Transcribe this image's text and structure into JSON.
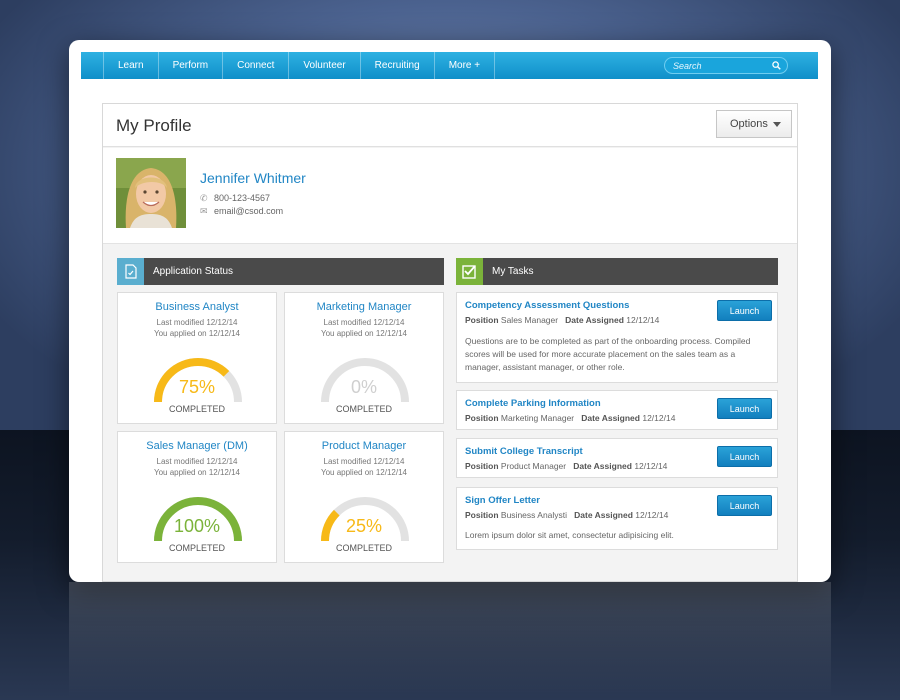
{
  "nav": {
    "items": [
      {
        "label": "Learn"
      },
      {
        "label": "Perform"
      },
      {
        "label": "Connect"
      },
      {
        "label": "Volunteer"
      },
      {
        "label": "Recruiting"
      },
      {
        "label": "More +"
      }
    ],
    "search_placeholder": "Search"
  },
  "header": {
    "title": "My Profile",
    "options_label": "Options"
  },
  "profile": {
    "name": "Jennifer Whitmer",
    "phone": "800-123-4567",
    "email": "email@csod.com"
  },
  "application_status": {
    "title": "Application Status",
    "cards": [
      {
        "title": "Business Analyst",
        "modified": "Last modified 12/12/14",
        "applied": "You applied on 12/12/14",
        "percent": 75,
        "percent_label": "75%",
        "status": "COMPLETED",
        "color": "#f7b918"
      },
      {
        "title": "Marketing Manager",
        "modified": "Last modified 12/12/14",
        "applied": "You applied on 12/12/14",
        "percent": 0,
        "percent_label": "0%",
        "status": "COMPLETED",
        "color": "#cccccc"
      },
      {
        "title": "Sales Manager (DM)",
        "modified": "Last modified 12/12/14",
        "applied": "You applied on 12/12/14",
        "percent": 100,
        "percent_label": "100%",
        "status": "COMPLETED",
        "color": "#7bb33a"
      },
      {
        "title": "Product Manager",
        "modified": "Last modified 12/12/14",
        "applied": "You applied on 12/12/14",
        "percent": 25,
        "percent_label": "25%",
        "status": "COMPLETED",
        "color": "#f7b918"
      }
    ]
  },
  "tasks": {
    "title": "My Tasks",
    "position_label": "Position",
    "date_label": "Date Assigned",
    "launch_label": "Launch",
    "items": [
      {
        "title": "Competency Assessment Questions",
        "position": "Sales Manager",
        "date": "12/12/14",
        "description": "Questions are to be completed as part of the onboarding process. Compiled scores will be used for more accurate placement on the sales team as a manager, assistant manager, or other role."
      },
      {
        "title": "Complete Parking Information",
        "position": "Marketing Manager",
        "date": "12/12/14",
        "description": ""
      },
      {
        "title": "Submit College Transcript",
        "position": "Product Manager",
        "date": "12/12/14",
        "description": ""
      },
      {
        "title": "Sign Offer Letter",
        "position": "Business Analysti",
        "date": "12/12/14",
        "description": "Lorem ipsum dolor sit amet, consectetur adipisicing elit."
      }
    ]
  },
  "colors": {
    "accent": "#1a9ed6",
    "link": "#2186c5",
    "app_status_icon": "#5aaecf",
    "tasks_icon": "#7bb33a"
  },
  "icons": {
    "search": "search-icon",
    "phone": "phone-icon",
    "email": "email-icon",
    "document": "document-icon",
    "checkbox": "checkbox-icon"
  }
}
